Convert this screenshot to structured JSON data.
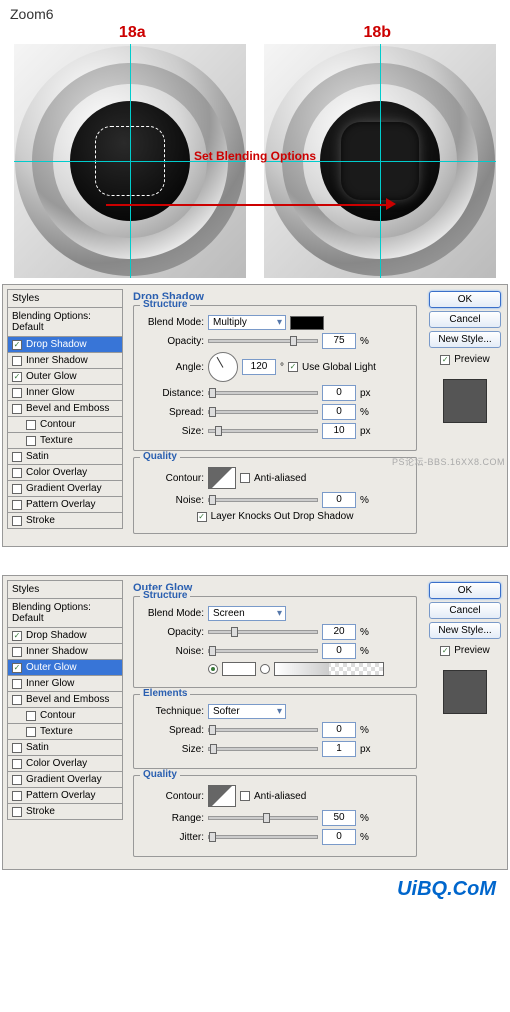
{
  "top": {
    "zoom": "Zoom6",
    "label_a": "18a",
    "label_b": "18b",
    "overlay_text": "Set Blending Options"
  },
  "styles_list": {
    "header": "Styles",
    "blending": "Blending Options: Default",
    "items": [
      {
        "label": "Drop Shadow"
      },
      {
        "label": "Inner Shadow"
      },
      {
        "label": "Outer Glow"
      },
      {
        "label": "Inner Glow"
      },
      {
        "label": "Bevel and Emboss"
      },
      {
        "label": "Contour"
      },
      {
        "label": "Texture"
      },
      {
        "label": "Satin"
      },
      {
        "label": "Color Overlay"
      },
      {
        "label": "Gradient Overlay"
      },
      {
        "label": "Pattern Overlay"
      },
      {
        "label": "Stroke"
      }
    ]
  },
  "panel1": {
    "checked": [
      true,
      false,
      true,
      false,
      false,
      false,
      false,
      false,
      false,
      false,
      false,
      false
    ],
    "selected": 0,
    "title": "Drop Shadow",
    "structure": {
      "title": "Structure",
      "blend_mode_lbl": "Blend Mode:",
      "blend_mode": "Multiply",
      "opacity_lbl": "Opacity:",
      "opacity": "75",
      "angle_lbl": "Angle:",
      "angle": "120",
      "angle_deg": "°",
      "use_global_lbl": "Use Global Light",
      "distance_lbl": "Distance:",
      "distance": "0",
      "spread_lbl": "Spread:",
      "spread": "0",
      "size_lbl": "Size:",
      "size": "10",
      "pct": "%",
      "px": "px"
    },
    "quality": {
      "title": "Quality",
      "contour_lbl": "Contour:",
      "aa_lbl": "Anti-aliased",
      "noise_lbl": "Noise:",
      "noise": "0",
      "pct": "%",
      "knock_lbl": "Layer Knocks Out Drop Shadow"
    }
  },
  "panel2": {
    "checked": [
      true,
      false,
      true,
      false,
      false,
      false,
      false,
      false,
      false,
      false,
      false,
      false
    ],
    "selected": 2,
    "title": "Outer Glow",
    "structure": {
      "title": "Structure",
      "blend_mode_lbl": "Blend Mode:",
      "blend_mode": "Screen",
      "opacity_lbl": "Opacity:",
      "opacity": "20",
      "noise_lbl": "Noise:",
      "noise": "0",
      "pct": "%"
    },
    "elements": {
      "title": "Elements",
      "technique_lbl": "Technique:",
      "technique": "Softer",
      "spread_lbl": "Spread:",
      "spread": "0",
      "size_lbl": "Size:",
      "size": "1",
      "pct": "%",
      "px": "px"
    },
    "quality": {
      "title": "Quality",
      "contour_lbl": "Contour:",
      "aa_lbl": "Anti-aliased",
      "range_lbl": "Range:",
      "range": "50",
      "jitter_lbl": "Jitter:",
      "jitter": "0",
      "pct": "%"
    }
  },
  "buttons": {
    "ok": "OK",
    "cancel": "Cancel",
    "new_style": "New Style...",
    "preview": "Preview"
  },
  "watermark": "PS论坛-BBS.16XX8.COM",
  "footer": "UiBQ.CoM"
}
